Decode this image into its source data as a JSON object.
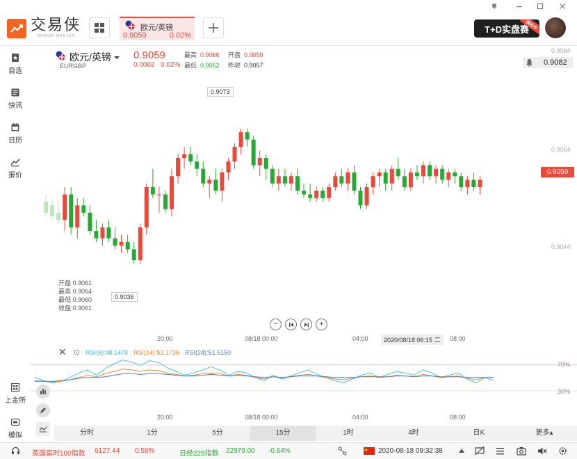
{
  "app": {
    "logo_cn": "交易侠",
    "logo_en": "TRADER MASTER"
  },
  "tab": {
    "name": "欧元/英镑",
    "price": "0.9059",
    "change_pct": "0.02%"
  },
  "banner": {
    "text": "T+D实盘赛",
    "tag": "报名中"
  },
  "sidebar": {
    "items": [
      {
        "label": "自选",
        "icon": "bookmark-icon"
      },
      {
        "label": "快讯",
        "icon": "news-icon"
      },
      {
        "label": "日历",
        "icon": "calendar-icon"
      },
      {
        "label": "报价",
        "icon": "trend-icon"
      },
      {
        "label": "上金所",
        "icon": "exchange-icon"
      },
      {
        "label": "模拟",
        "icon": "simulate-icon"
      }
    ]
  },
  "quote": {
    "title": "欧元/英镑",
    "code": "EURGBP",
    "price": "0.9059",
    "change": "0.0002",
    "change_pct": "0.02%",
    "high_label": "最高",
    "high": "0.9066",
    "low_label": "最低",
    "low": "0.9052",
    "open_label": "开盘",
    "open": "0.9059",
    "prev_label": "昨收",
    "prev": "0.9057",
    "alert_price": "0.9082"
  },
  "chart": {
    "hover": {
      "open": "开盘 0.9061",
      "high": "最高 0.9064",
      "low": "最低 0.9060",
      "close": "收盘 0.9061"
    },
    "max_label": "0.9073",
    "min_label": "0.9036",
    "right_ticks": [
      "0.9084",
      "0.9064",
      "0.9044"
    ],
    "current_price": "0.9059",
    "time_ticks": [
      "20:00",
      "08/18 00:00",
      "04:00",
      "08:00"
    ],
    "crosshair_time": "2020/08/18 06:15 二",
    "nav_icons": [
      "zoom-out-icon",
      "prev-icon",
      "next-icon",
      "zoom-in-icon"
    ]
  },
  "chart_data": [
    {
      "type": "candlestick",
      "title": "",
      "x_ticks": [
        "20:00",
        "08/18 00:00",
        "04:00",
        "08:00"
      ],
      "y_ticks": [
        0.9084,
        0.9064,
        0.9044
      ],
      "ylim": [
        0.903,
        0.9088
      ],
      "max": 0.9073,
      "min": 0.9036,
      "current": 0.9059,
      "candles": [
        [
          0.9053,
          0.9055,
          0.9049,
          0.905
        ],
        [
          0.9052,
          0.9054,
          0.9048,
          0.9049
        ],
        [
          0.905,
          0.9053,
          0.9047,
          0.9048
        ],
        [
          0.9048,
          0.9057,
          0.9045,
          0.9055
        ],
        [
          0.9055,
          0.9057,
          0.9044,
          0.9046
        ],
        [
          0.9046,
          0.9054,
          0.9043,
          0.9052
        ],
        [
          0.9052,
          0.9054,
          0.9049,
          0.905
        ],
        [
          0.905,
          0.9052,
          0.9044,
          0.9045
        ],
        [
          0.9045,
          0.9048,
          0.9042,
          0.9043
        ],
        [
          0.9043,
          0.9047,
          0.9041,
          0.9046
        ],
        [
          0.9046,
          0.9048,
          0.9042,
          0.9043
        ],
        [
          0.9043,
          0.9046,
          0.904,
          0.9041
        ],
        [
          0.9041,
          0.9044,
          0.9039,
          0.9042
        ],
        [
          0.9042,
          0.9044,
          0.9039,
          0.904
        ],
        [
          0.904,
          0.9042,
          0.9036,
          0.9037
        ],
        [
          0.9037,
          0.9047,
          0.9036,
          0.9046
        ],
        [
          0.9046,
          0.9058,
          0.9044,
          0.9057
        ],
        [
          0.9057,
          0.9062,
          0.9054,
          0.9055
        ],
        [
          0.9055,
          0.9057,
          0.905,
          0.9055
        ],
        [
          0.9055,
          0.9056,
          0.905,
          0.9051
        ],
        [
          0.9051,
          0.9062,
          0.9049,
          0.906
        ],
        [
          0.906,
          0.9066,
          0.9058,
          0.9065
        ],
        [
          0.9065,
          0.9068,
          0.9062,
          0.9066
        ],
        [
          0.9066,
          0.9068,
          0.9063,
          0.9064
        ],
        [
          0.9064,
          0.9066,
          0.906,
          0.9062
        ],
        [
          0.9062,
          0.9064,
          0.9057,
          0.9058
        ],
        [
          0.9058,
          0.906,
          0.9054,
          0.9059
        ],
        [
          0.9059,
          0.9062,
          0.9055,
          0.9056
        ],
        [
          0.9056,
          0.9062,
          0.9053,
          0.9061
        ],
        [
          0.9061,
          0.9065,
          0.9059,
          0.9064
        ],
        [
          0.9064,
          0.9069,
          0.9062,
          0.9068
        ],
        [
          0.9068,
          0.9073,
          0.9066,
          0.9072
        ],
        [
          0.9072,
          0.9073,
          0.9068,
          0.907
        ],
        [
          0.907,
          0.9071,
          0.9062,
          0.9063
        ],
        [
          0.9063,
          0.9067,
          0.906,
          0.9065
        ],
        [
          0.9065,
          0.9066,
          0.9059,
          0.9062
        ],
        [
          0.9062,
          0.9063,
          0.9057,
          0.9058
        ],
        [
          0.9058,
          0.9062,
          0.9056,
          0.906
        ],
        [
          0.906,
          0.9062,
          0.9057,
          0.9058
        ],
        [
          0.9058,
          0.9061,
          0.9056,
          0.906
        ],
        [
          0.906,
          0.9062,
          0.9055,
          0.9056
        ],
        [
          0.9056,
          0.9058,
          0.9054,
          0.9055
        ],
        [
          0.9055,
          0.9058,
          0.9053,
          0.9054
        ],
        [
          0.9054,
          0.9057,
          0.9053,
          0.9056
        ],
        [
          0.9056,
          0.9057,
          0.9053,
          0.9054
        ],
        [
          0.9054,
          0.9058,
          0.9053,
          0.9057
        ],
        [
          0.9057,
          0.9061,
          0.9056,
          0.906
        ],
        [
          0.906,
          0.9062,
          0.9057,
          0.9058
        ],
        [
          0.9058,
          0.9062,
          0.9056,
          0.9061
        ],
        [
          0.9061,
          0.9063,
          0.9055,
          0.9056
        ],
        [
          0.9056,
          0.9057,
          0.9051,
          0.9052
        ],
        [
          0.9052,
          0.9058,
          0.9051,
          0.9057
        ],
        [
          0.9057,
          0.9061,
          0.9055,
          0.906
        ],
        [
          0.906,
          0.9062,
          0.9057,
          0.9061
        ],
        [
          0.9061,
          0.9062,
          0.9056,
          0.9058
        ],
        [
          0.9058,
          0.9063,
          0.9056,
          0.9062
        ],
        [
          0.9062,
          0.9065,
          0.9059,
          0.906
        ],
        [
          0.906,
          0.9062,
          0.9056,
          0.9057
        ],
        [
          0.9057,
          0.9062,
          0.9056,
          0.9061
        ],
        [
          0.9061,
          0.9063,
          0.9059,
          0.906
        ],
        [
          0.906,
          0.9064,
          0.9058,
          0.9063
        ],
        [
          0.9063,
          0.9064,
          0.9059,
          0.906
        ],
        [
          0.906,
          0.9063,
          0.9058,
          0.9062
        ],
        [
          0.9062,
          0.9063,
          0.9058,
          0.9059
        ],
        [
          0.9059,
          0.9062,
          0.9057,
          0.9061
        ],
        [
          0.9061,
          0.9062,
          0.9058,
          0.906
        ],
        [
          0.906,
          0.9061,
          0.9056,
          0.9057
        ],
        [
          0.9057,
          0.906,
          0.9055,
          0.9059
        ],
        [
          0.9059,
          0.9061,
          0.9056,
          0.9057
        ],
        [
          0.9057,
          0.906,
          0.9055,
          0.9059
        ]
      ]
    },
    {
      "type": "line",
      "title": "",
      "series": [
        {
          "name": "RSI(6):48.1478",
          "values": [
            52,
            48,
            45,
            47,
            52,
            58,
            62,
            55,
            64,
            70,
            75,
            72,
            68,
            74,
            72,
            65,
            60,
            55,
            58,
            62,
            66,
            62,
            55,
            60,
            58,
            52,
            48,
            55,
            50,
            54,
            58,
            62,
            56,
            52,
            48,
            45,
            50,
            55,
            58,
            52,
            56,
            60,
            58,
            55,
            62,
            58,
            52,
            55,
            58,
            50,
            45,
            52,
            48
          ]
        },
        {
          "name": "RSI(14):52.1736",
          "values": [
            48,
            47,
            46,
            47,
            49,
            52,
            55,
            53,
            57,
            60,
            63,
            62,
            60,
            62,
            61,
            58,
            56,
            54,
            55,
            57,
            58,
            57,
            54,
            56,
            55,
            52,
            50,
            53,
            51,
            53,
            55,
            56,
            54,
            52,
            50,
            49,
            51,
            53,
            54,
            52,
            53,
            55,
            54,
            53,
            56,
            54,
            52,
            53,
            54,
            51,
            49,
            52,
            52
          ]
        },
        {
          "name": "RSI(24):51.5150",
          "values": [
            47,
            47,
            47,
            48,
            49,
            51,
            52,
            52,
            53,
            55,
            57,
            57,
            56,
            57,
            57,
            56,
            55,
            54,
            54,
            55,
            56,
            55,
            54,
            55,
            54,
            53,
            52,
            53,
            52,
            53,
            54,
            54,
            54,
            53,
            52,
            52,
            52,
            53,
            53,
            53,
            53,
            54,
            54,
            53,
            54,
            54,
            53,
            53,
            53,
            52,
            52,
            52,
            52
          ]
        }
      ],
      "ylim": [
        0,
        100
      ],
      "levels": [
        70,
        30
      ],
      "x_ticks": [
        "20:00",
        "08/18 00:00",
        "04:00",
        "08:00"
      ]
    }
  ],
  "rsi": {
    "label6": "RSI(6):48.1478",
    "label14": "RSI(14):52.1736",
    "label24": "RSI(24):51.5150",
    "c6": "#3fc5d8",
    "c14": "#f08a24",
    "c24": "#4a7bd4",
    "lvl_high": "70%",
    "lvl_low": "30%"
  },
  "periods": [
    {
      "label": "分时",
      "active": false
    },
    {
      "label": "1分",
      "active": false
    },
    {
      "label": "5分",
      "active": false
    },
    {
      "label": "15分",
      "active": true
    },
    {
      "label": "1时",
      "active": false
    },
    {
      "label": "4时",
      "active": false
    },
    {
      "label": "日K",
      "active": false
    },
    {
      "label": "更多▴",
      "active": false
    }
  ],
  "bottom": {
    "idx1_name": "英国富时100指数",
    "idx1_value": "6127.44",
    "idx1_change": "0.58%",
    "idx2_name": "日经225指数",
    "idx2_value": "22979.00",
    "idx2_change": "-0.64%",
    "datetime": "2020-08-18 09:32:38"
  },
  "colors": {
    "up": "#e84b3c",
    "down": "#2aa835",
    "accent": "#f26522"
  }
}
